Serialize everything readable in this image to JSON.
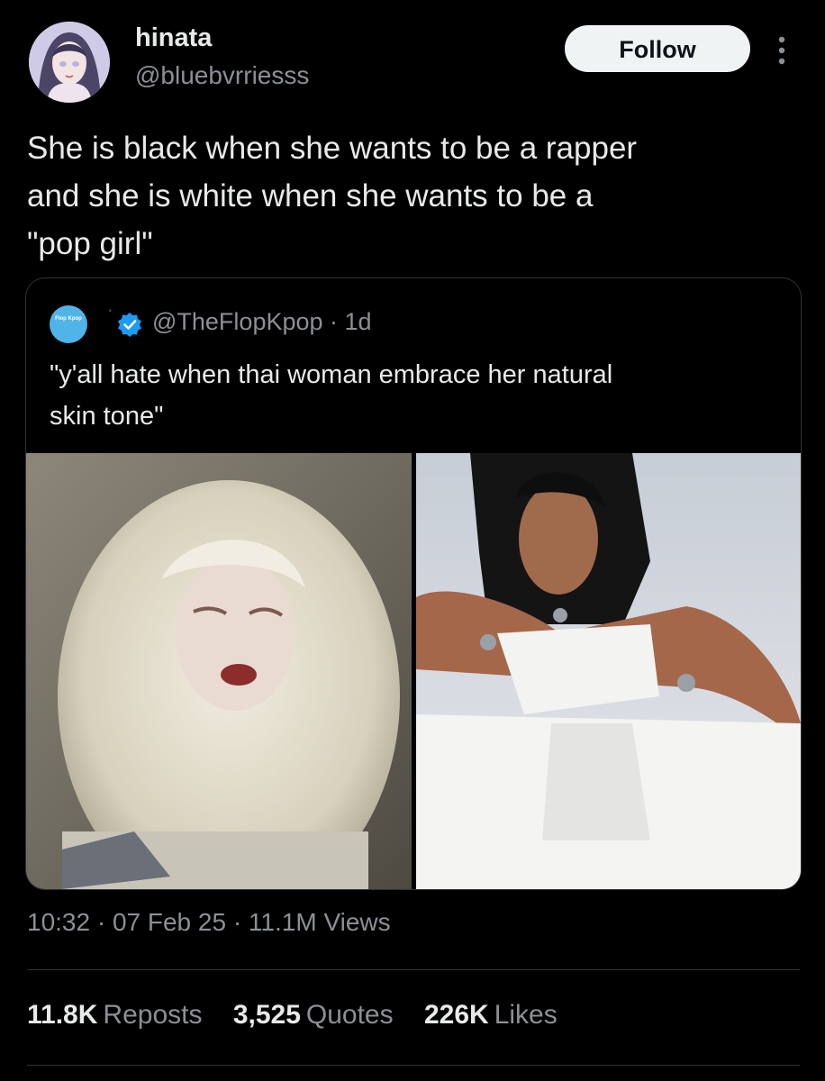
{
  "author": {
    "display_name": "hinata",
    "handle": "@bluebvrriesss",
    "avatar_icon": "anime-girl-avatar"
  },
  "follow_label": "Follow",
  "more_icon": "more-dots-icon",
  "tweet_text": "She is black when she wants to be a rapper\nand she is white when she wants to be a\n\"pop girl\"",
  "quote": {
    "handle_time": "@TheFlopKpop · 1d",
    "text": "\"y'all hate when thai woman embrace her natural\nskin tone\"",
    "avatar_label": "Flop Kpop",
    "verified_icon": "verified-badge-icon"
  },
  "meta": {
    "time": "10:32",
    "date": "07 Feb 25",
    "views_count": "11.1M",
    "views_label": "Views",
    "line": "10:32 · 07 Feb 25 · 11.1M Views"
  },
  "stats": [
    {
      "num": "11.8K",
      "label": "Reposts"
    },
    {
      "num": "3,525",
      "label": "Quotes"
    },
    {
      "num": "226K",
      "label": "Likes"
    }
  ],
  "colors": {
    "background": "#000000",
    "text": "#e7e9ea",
    "secondary_text": "#8b9096",
    "border": "#2f3336",
    "follow_bg": "#eff3f4",
    "verified": "#1d9bf0"
  }
}
